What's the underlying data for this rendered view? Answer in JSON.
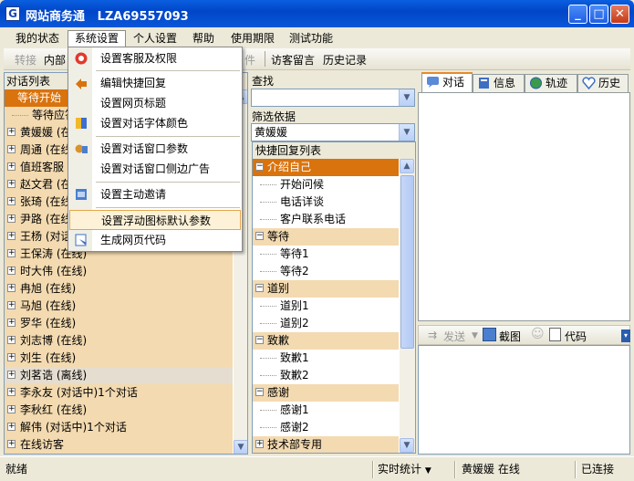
{
  "window": {
    "app_name": "网站商务通",
    "account": "LZA69557093",
    "min": "_",
    "max": "□",
    "close": "✕"
  },
  "menubar": [
    "我的状态",
    "系统设置",
    "个人设置",
    "帮助",
    "使用期限",
    "测试功能"
  ],
  "toolbar": {
    "transfer": "转接",
    "internal": "内部",
    "file": "件",
    "visitor_msg": "访客留言",
    "history": "历史记录"
  },
  "system_menu": {
    "items": [
      "设置客服及权限",
      "编辑快捷回复",
      "设置网页标题",
      "设置对话字体颜色",
      "设置对话窗口参数",
      "设置对话窗口侧边广告",
      "设置主动邀请",
      "设置浮动图标默认参数",
      "生成网页代码"
    ]
  },
  "left_panel": {
    "title": "对话列表",
    "rows": [
      {
        "text": "等待开始",
        "type": "group"
      },
      {
        "text": "等待应答",
        "type": "child"
      },
      {
        "text": "黄媛媛  (在线)",
        "type": "node"
      },
      {
        "text": "周通  (在线)",
        "type": "node"
      },
      {
        "text": "值班客服",
        "type": "node"
      },
      {
        "text": "赵文君  (在线)",
        "type": "node"
      },
      {
        "text": "张琦  (在线)",
        "type": "node"
      },
      {
        "text": "尹路  (在线)",
        "type": "node"
      },
      {
        "text": "王杨  (对话中)",
        "type": "node"
      },
      {
        "text": "王保涛  (在线)",
        "type": "node"
      },
      {
        "text": "时大伟  (在线)",
        "type": "node"
      },
      {
        "text": "冉旭  (在线)",
        "type": "node"
      },
      {
        "text": "马旭  (在线)",
        "type": "node"
      },
      {
        "text": "罗华  (在线)",
        "type": "node"
      },
      {
        "text": "刘志博  (在线)",
        "type": "node"
      },
      {
        "text": "刘生  (在线)",
        "type": "node"
      },
      {
        "text": "刘茗诰  (离线)",
        "type": "offline"
      },
      {
        "text": "李永友  (对话中)1个对话",
        "type": "node"
      },
      {
        "text": "李秋红  (在线)",
        "type": "node"
      },
      {
        "text": "解伟  (对话中)1个对话",
        "type": "node"
      },
      {
        "text": "在线访客",
        "type": "node"
      }
    ]
  },
  "middle_panel": {
    "search_label": "查找",
    "search_value": "",
    "filter_label": "筛选依据",
    "filter_value": "黄媛媛",
    "list_title": "快捷回复列表",
    "rows": [
      {
        "text": "介绍自己",
        "type": "group-sel"
      },
      {
        "text": "开始问候",
        "type": "child"
      },
      {
        "text": "电话详谈",
        "type": "child"
      },
      {
        "text": "客户联系电话",
        "type": "child"
      },
      {
        "text": "等待",
        "type": "group"
      },
      {
        "text": "等待1",
        "type": "child"
      },
      {
        "text": "等待2",
        "type": "child"
      },
      {
        "text": "道别",
        "type": "group"
      },
      {
        "text": "道别1",
        "type": "child"
      },
      {
        "text": "道别2",
        "type": "child"
      },
      {
        "text": "致歉",
        "type": "group"
      },
      {
        "text": "致歉1",
        "type": "child"
      },
      {
        "text": "致歉2",
        "type": "child"
      },
      {
        "text": "感谢",
        "type": "group"
      },
      {
        "text": "感谢1",
        "type": "child"
      },
      {
        "text": "感谢2",
        "type": "child"
      },
      {
        "text": "技术部专用",
        "type": "group"
      }
    ]
  },
  "right_panel": {
    "tabs": [
      "对话",
      "信息",
      "轨迹",
      "历史"
    ],
    "chat_toolbar": {
      "send": "发送",
      "screenshot": "截图",
      "code": "代码"
    }
  },
  "statusbar": {
    "ready": "就绪",
    "realtime": "实时统计",
    "user": "黄媛媛  在线",
    "conn": "已连接"
  },
  "colors": {
    "selected": "#d9730d",
    "row_bg": "#f3dab0",
    "title_blue": "#0146c8"
  }
}
